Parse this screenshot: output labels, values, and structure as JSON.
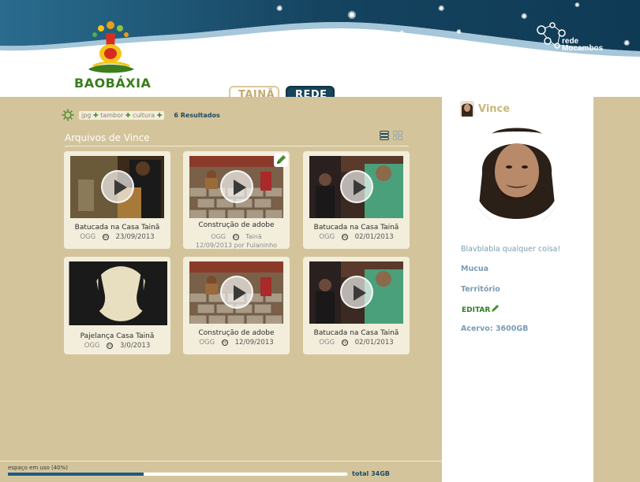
{
  "app": {
    "logo_text": "BAOBÁXIA",
    "network_logo": {
      "line1": "rede",
      "line2": "Mocambos"
    }
  },
  "tabs": [
    {
      "label": "TAINÃ",
      "active": false
    },
    {
      "label": "REDE",
      "active": true
    }
  ],
  "filter": {
    "tags": [
      "jpg",
      "tambor",
      "cultura"
    ],
    "result_count": "6 Resultados",
    "icon": "gear-sun-icon"
  },
  "section": {
    "title": "Arquivos de Vince"
  },
  "view_icons": [
    "list-view-icon",
    "grid-view-icon"
  ],
  "cards": [
    {
      "title": "Batucada na Casa Tainã",
      "format": "OGG",
      "date": "23/09/2013",
      "thumb": "drummer"
    },
    {
      "title": "Construção de adobe",
      "format": "OGG",
      "date": "Tainã",
      "extra": "12/09/2013 por Fulaninho",
      "thumb": "adobe",
      "editable": true
    },
    {
      "title": "Batucada na Casa Tainã",
      "format": "OGG",
      "date": "02/01/2013",
      "thumb": "group"
    },
    {
      "title": "Pajelança Casa Tainã",
      "format": "OGG",
      "date": "3/0/2013",
      "thumb": "hands"
    },
    {
      "title": "Construção de adobe",
      "format": "OGG",
      "date": "12/09/2013",
      "thumb": "adobe"
    },
    {
      "title": "Batucada na Casa Tainã",
      "format": "OGG",
      "date": "02/01/2013",
      "thumb": "group"
    }
  ],
  "profile": {
    "name": "Vince",
    "bio": "Blavblabla qualquer coisa!",
    "link1": "Mucua",
    "link2": "Território",
    "edit_label": "EDITAR",
    "storage": "Acervo: 3600GB"
  },
  "usage": {
    "label": "espaço em uso (40%)",
    "percent": 40,
    "total": "total 34GB"
  },
  "colors": {
    "panel": "#d3c49b",
    "header_blue": "#17445a",
    "accent_green": "#4a8a2a",
    "link_blue": "#7a9cb3"
  }
}
